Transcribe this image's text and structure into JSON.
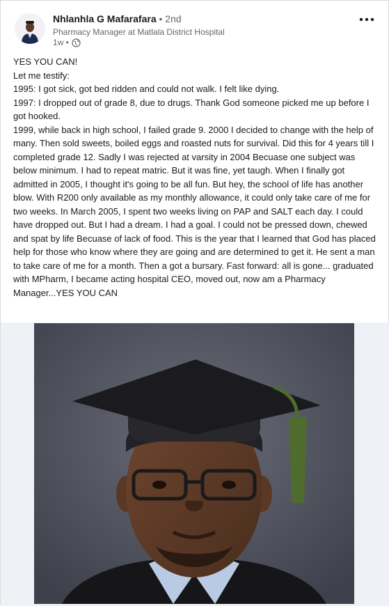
{
  "author": {
    "name": "Nhlanhla G Mafarafara",
    "degree": "• 2nd",
    "headline": "Pharmacy Manager at Matlala District Hospital",
    "time": "1w •",
    "visibility_icon": "globe-icon"
  },
  "menu": {
    "icon": "more-horizontal-icon"
  },
  "post": {
    "lines": [
      "YES YOU CAN!",
      "Let me testify:",
      "1995: I got sick, got bed ridden and could not walk. I felt like dying.",
      "1997: I dropped out of grade 8, due to drugs. Thank God someone picked me up before I got hooked.",
      "1999, while back in high school, I failed grade 9. 2000 I decided to change with the help of many. Then sold sweets, boiled eggs and roasted nuts for survival. Did this for 4 years till I completed grade 12. Sadly I was rejected at varsity in 2004 Becuase one subject was below minimum. I had to repeat matric. But it was fine, yet taugh. When I finally got admitted in 2005, I thought it's going to be all fun. But hey, the school of life has another blow. With R200 only available as my monthly allowance, it could only take care of me for two weeks. In March 2005, I spent two weeks living on PAP and SALT each day. I could have dropped out. But I had a dream. I had a goal. I could not be pressed down, chewed and spat by life Becuase of lack of food. This is the year that I learned that God has placed help for those who know where they are going and are determined to get it. He sent a man to take care of me for a month. Then a got a bursary. Fast forward: all is gone... graduated with MPharm, I became acting hospital CEO, moved out, now am a Pharmacy Manager...YES YOU CAN"
    ]
  },
  "colors": {
    "text": "#191919",
    "muted": "#666666",
    "image_background": "#eef2f6",
    "photo_backdrop": "#4b4e58",
    "cap": "#1f1f22",
    "tassel": "#4f6b2e"
  }
}
